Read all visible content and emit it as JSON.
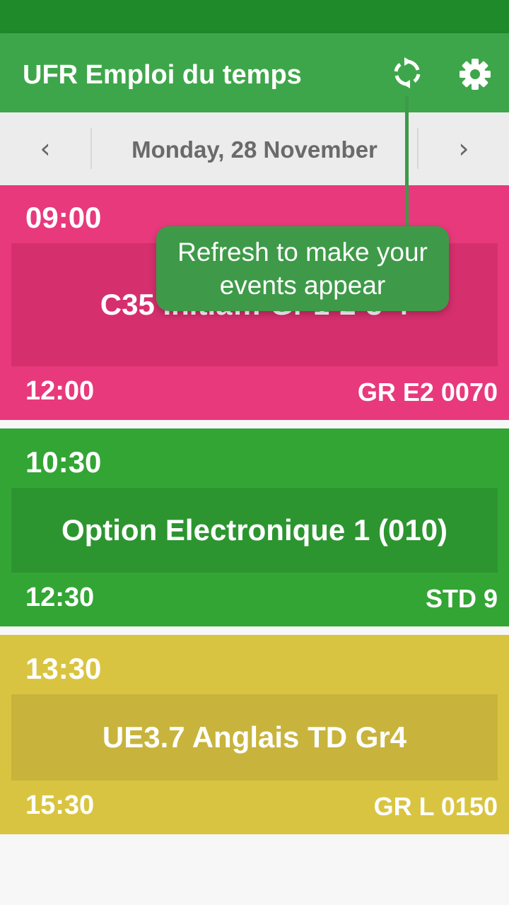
{
  "app_bar": {
    "title": "UFR Emploi du temps",
    "refresh_icon": "refresh-icon",
    "settings_icon": "gear-icon",
    "color": "#3ea64a"
  },
  "date_nav": {
    "prev_label": "‹",
    "date": "Monday, 28 November",
    "next_label": "›"
  },
  "events": [
    {
      "start": "09:00",
      "title": "C35 Initia… Gr 1-2-3-4",
      "end": "12:00",
      "room": "GR E2 0070",
      "color": "#e8397c"
    },
    {
      "start": "10:30",
      "title": "Option Electronique 1 (010)",
      "end": "12:30",
      "room": "STD 9",
      "color": "#33a535"
    },
    {
      "start": "13:30",
      "title": "UE3.7 Anglais TD Gr4",
      "end": "15:30",
      "room": "GR L 0150",
      "color": "#d9c441"
    }
  ],
  "tooltip": {
    "text": "Refresh to make your events appear"
  }
}
